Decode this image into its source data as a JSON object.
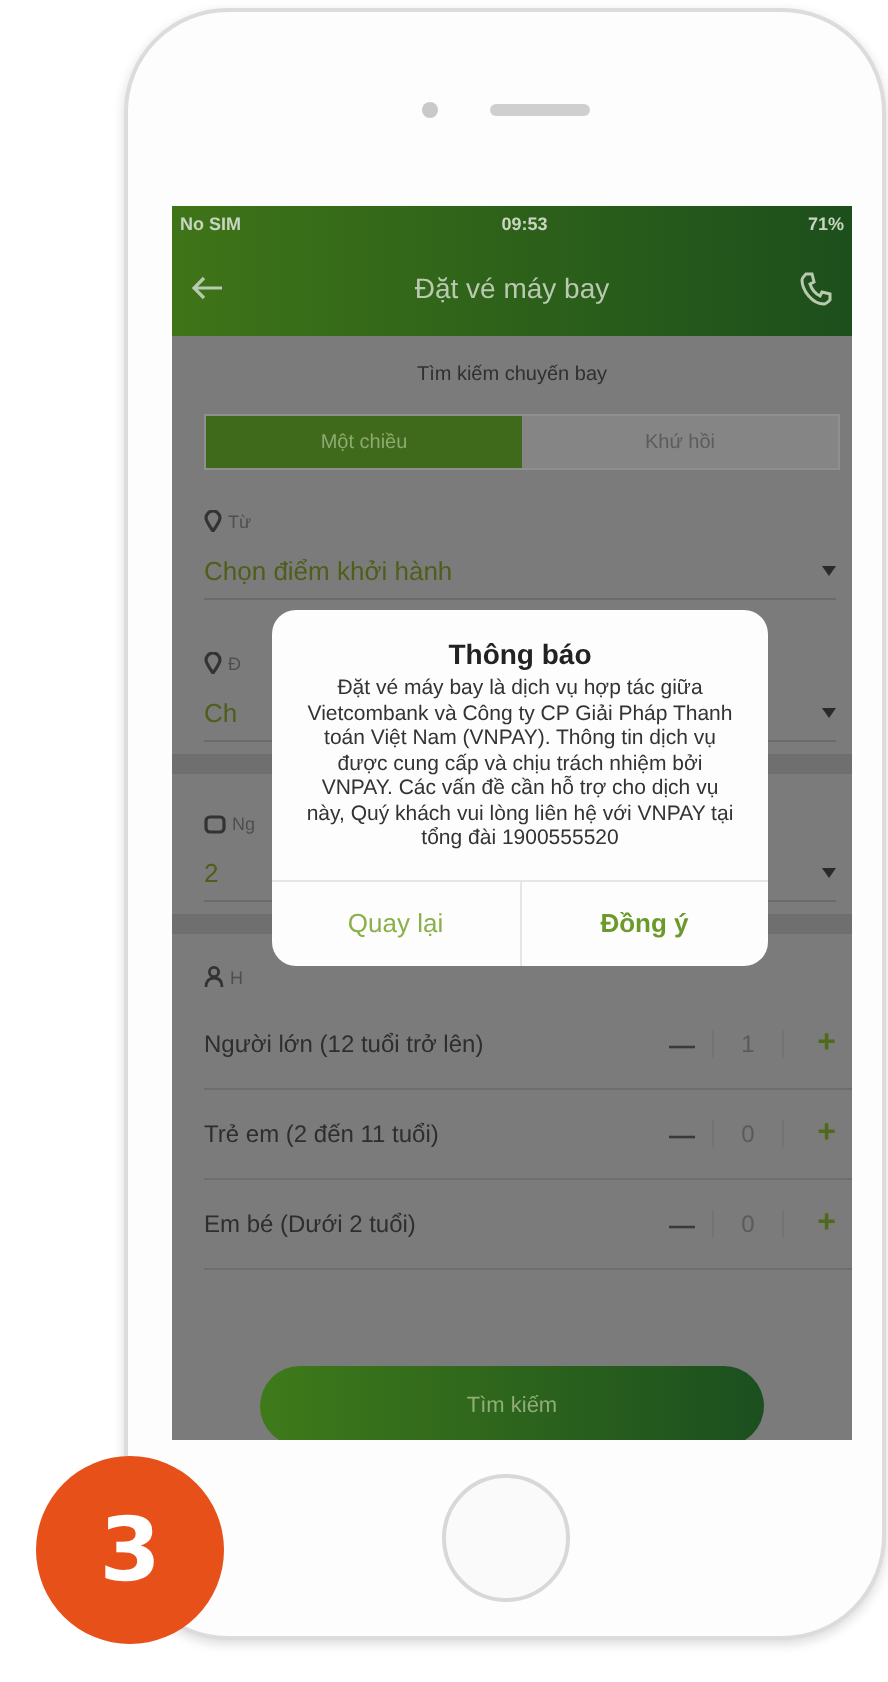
{
  "status_bar": {
    "carrier": "No SIM",
    "time": "09:53",
    "battery": "71%"
  },
  "nav": {
    "title": "Đặt vé máy bay"
  },
  "section_title": "Tìm kiếm chuyến bay",
  "trip_tabs": [
    {
      "label": "Một chiều",
      "selected": true
    },
    {
      "label": "Khứ hồi",
      "selected": false
    }
  ],
  "fields": [
    {
      "label": "Từ",
      "value": "Chọn điểm khởi hành"
    },
    {
      "label": "Đ",
      "value": "Ch"
    },
    {
      "label": "Ng",
      "value": "2"
    }
  ],
  "passengers": {
    "label": "H",
    "rows": [
      {
        "name": "Người lớn (12 tuổi trở lên)",
        "minus": "—",
        "count": "1",
        "plus": "+"
      },
      {
        "name": "Trẻ em (2 đến 11 tuổi)",
        "minus": "—",
        "count": "0",
        "plus": "+"
      },
      {
        "name": "Em bé (Dưới 2 tuổi)",
        "minus": "—",
        "count": "0",
        "plus": "+"
      }
    ]
  },
  "search_button": "Tìm kiếm",
  "dialog": {
    "title": "Thông báo",
    "message": "Đặt vé máy bay là dịch vụ hợp tác giữa Vietcombank và Công ty CP Giải Pháp Thanh toán Việt Nam (VNPAY). Thông tin dịch vụ được cung cấp và chịu trách nhiệm bởi VNPAY. Các vấn đề cần hỗ trợ cho dịch vụ này, Quý khách vui lòng liên hệ với VNPAY tại tổng đài 1900555520",
    "buttons": [
      "Quay lại",
      "Đồng ý"
    ]
  },
  "step_badge": "3"
}
